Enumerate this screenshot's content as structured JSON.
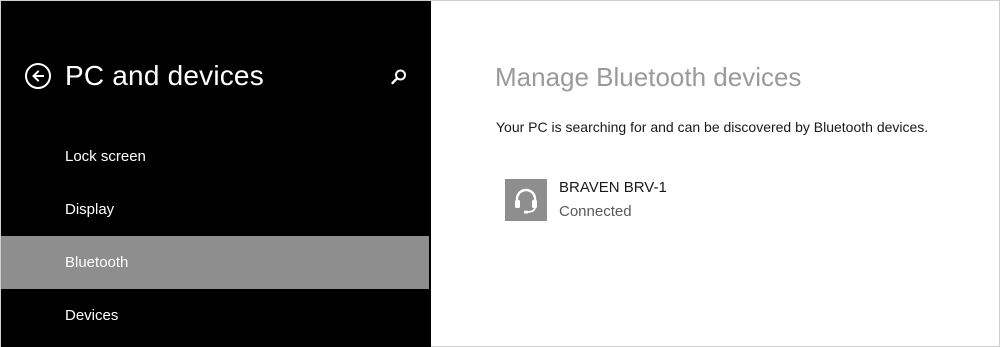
{
  "sidebar": {
    "title": "PC and devices",
    "back_icon": "back-arrow-icon",
    "search_icon": "search-icon",
    "items": [
      {
        "label": "Lock screen",
        "selected": false
      },
      {
        "label": "Display",
        "selected": false
      },
      {
        "label": "Bluetooth",
        "selected": true
      },
      {
        "label": "Devices",
        "selected": false
      }
    ]
  },
  "main": {
    "title": "Manage Bluetooth devices",
    "description": "Your PC is searching for and can be discovered by Bluetooth devices.",
    "devices": [
      {
        "name": "BRAVEN BRV-1",
        "status": "Connected",
        "icon": "headset-icon"
      }
    ]
  },
  "colors": {
    "sidebar_background": "#000000",
    "selected_item": "#8e8e8e",
    "content_title": "#9a9a9a",
    "device_tile": "#8e8e8e"
  }
}
